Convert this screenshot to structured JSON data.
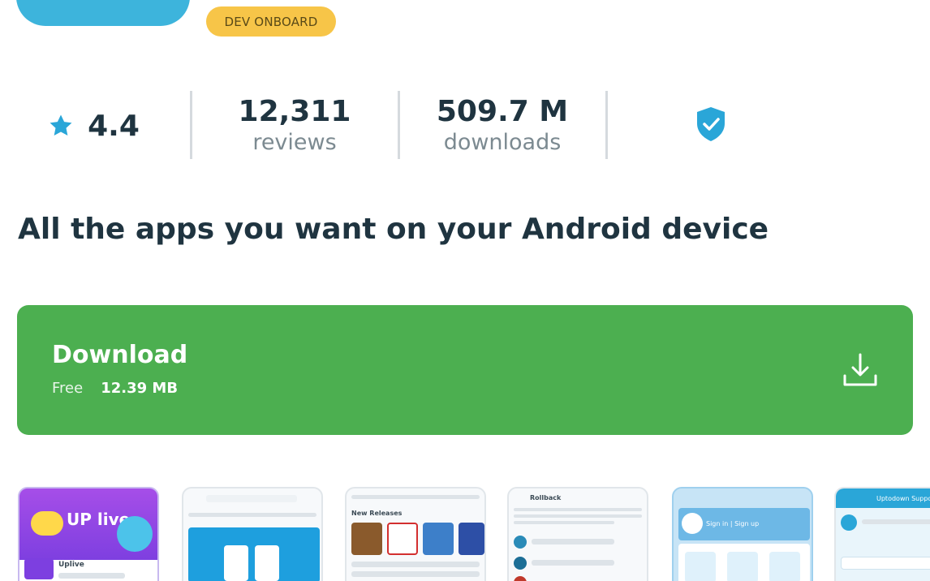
{
  "badge": {
    "label": "DEV ONBOARD"
  },
  "stats": {
    "rating": "4.4",
    "reviews_value": "12,311",
    "reviews_label": "reviews",
    "downloads_value": "509.7 M",
    "downloads_label": "downloads"
  },
  "headline": "All the apps you want on your Android device",
  "download": {
    "title": "Download",
    "price": "Free",
    "size": "12.39 MB"
  },
  "screenshots": {
    "s1_app_name": "Uplive",
    "s1_logo": "UP live",
    "s3_section": "New Releases",
    "s4_title": "Rollback",
    "s5_signin": "Sign in | Sign up",
    "s6_title": "Uptodown Support"
  },
  "colors": {
    "accent_blue": "#3db4dc",
    "badge_yellow": "#f7c548",
    "download_green": "#4caf50",
    "text_dark": "#1f3440"
  },
  "icons": [
    "star-icon",
    "shield-check-icon",
    "download-icon"
  ]
}
